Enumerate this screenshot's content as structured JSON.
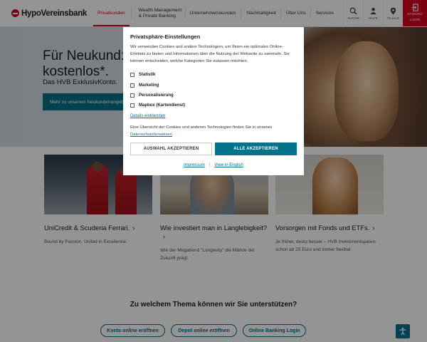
{
  "header": {
    "brand": "HypoVereinsbank",
    "nav": [
      {
        "label": "Privatkunden",
        "active": true
      },
      {
        "label": "Wealth Management & Private Banking",
        "active": false
      },
      {
        "label": "Unternehmenskunden",
        "active": false
      },
      {
        "label": "Nachhaltigkeit",
        "active": false
      },
      {
        "label": "Über Uns",
        "active": false
      },
      {
        "label": "Services",
        "active": false
      }
    ],
    "tools": {
      "search": "SUCHE",
      "help": "HILFE",
      "branch": "FILIALE"
    },
    "banking_line1": "BANKING",
    "banking_line2": "LOGIN"
  },
  "hero": {
    "title_line1": "Für Neukund:inn",
    "title_line2": "kostenlos*.",
    "subtitle": "Das HVB ExklusivKonto.",
    "cta": "Mehr zu unserem Neukundenangebot"
  },
  "cards": [
    {
      "title": "UniCredit & Scuderia Ferrari.",
      "text": "Bound by Passion. United in Excellence."
    },
    {
      "title": "Wie investiert man in Langlebigkeit?",
      "text": "Wie der Megatrend \"Longevity\" die Märkte der Zukunft prägt."
    },
    {
      "title": "Vorsorgen mit Fonds und ETFs.",
      "text": "Je früher, desto besser – HVB Investmentsparen: schon ab 25 Euro und immer flexibel."
    }
  ],
  "bottom": {
    "question": "Zu welchem Thema können wir Sie unterstützen?",
    "pills": [
      "Konto online eröffnen",
      "Depot online eröffnen",
      "Online Banking Login"
    ]
  },
  "modal": {
    "title": "Privatsphäre-Einstellungen",
    "intro": "Wir verwenden Cookies und andere Technologien, um Ihnen ein optimales Online-Erlebnis zu bieten und Informationen über die Nutzung der Webseite zu sammeln. Sie können entscheiden, welche Kategorien Sie zulassen möchten.",
    "options": [
      "Statistik",
      "Marketing",
      "Personalisierung",
      "Mapbox (Kartendienst)"
    ],
    "details_link": "Details einblenden",
    "overview_text": "Eine Übersicht der Cookies und anderen Technologien finden Sie in unseren",
    "privacy_link": "Datenschutzhinweisen",
    "btn_selection": "AUSWAHL AKZEPTIEREN",
    "btn_all": "ALLE AKZEPTIEREN",
    "imprint": "Impressum",
    "view_english": "View in English"
  },
  "colors": {
    "brand_red": "#d6001c",
    "teal": "#00738a"
  }
}
